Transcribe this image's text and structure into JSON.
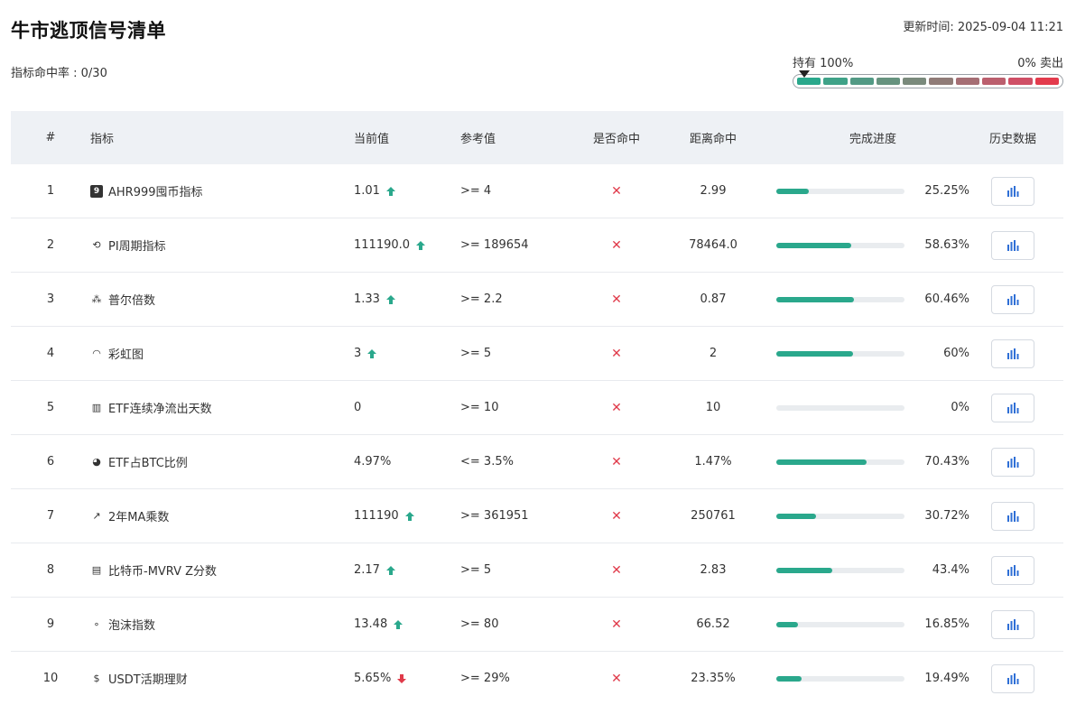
{
  "header": {
    "title": "牛市逃顶信号清单",
    "update_time": "更新时间: 2025-09-04 11:21",
    "hit_rate": "指标命中率 : 0/30"
  },
  "gauge": {
    "left_label": "持有 100%",
    "right_label": "0% 卖出",
    "position_fraction": 0.0,
    "segments": [
      "#2aa88c",
      "#3fa288",
      "#529a85",
      "#66937f",
      "#7a8a7c",
      "#907c78",
      "#a56e74",
      "#bb5f6e",
      "#cf4f66",
      "#e33b4d"
    ]
  },
  "table": {
    "columns": [
      "#",
      "指标",
      "当前值",
      "参考值",
      "是否命中",
      "距离命中",
      "完成进度",
      "历史数据"
    ],
    "rows": [
      {
        "num": "1",
        "icon": "nine-badge-icon",
        "icon_glyph": "9",
        "name": "AHR999囤币指标",
        "current": "1.01",
        "trend": "up",
        "ref": ">= 4",
        "hit": "✕",
        "distance": "2.99",
        "progress": 25.25,
        "progress_label": "25.25%"
      },
      {
        "num": "2",
        "icon": "cycle-icon",
        "icon_glyph": "⟲",
        "name": "PI周期指标",
        "current": "111190.0",
        "trend": "up",
        "ref": ">= 189654",
        "hit": "✕",
        "distance": "78464.0",
        "progress": 58.63,
        "progress_label": "58.63%"
      },
      {
        "num": "3",
        "icon": "sparkle-icon",
        "icon_glyph": "⁂",
        "name": "普尔倍数",
        "current": "1.33",
        "trend": "up",
        "ref": ">= 2.2",
        "hit": "✕",
        "distance": "0.87",
        "progress": 60.46,
        "progress_label": "60.46%"
      },
      {
        "num": "4",
        "icon": "rainbow-icon",
        "icon_glyph": "◠",
        "name": "彩虹图",
        "current": "3",
        "trend": "up",
        "ref": ">= 5",
        "hit": "✕",
        "distance": "2",
        "progress": 60,
        "progress_label": "60%"
      },
      {
        "num": "5",
        "icon": "bar-chart-icon",
        "icon_glyph": "▥",
        "name": "ETF连续净流出天数",
        "current": "0",
        "trend": "none",
        "ref": ">= 10",
        "hit": "✕",
        "distance": "10",
        "progress": 0,
        "progress_label": "0%"
      },
      {
        "num": "6",
        "icon": "pie-chart-icon",
        "icon_glyph": "◕",
        "name": "ETF占BTC比例",
        "current": "4.97%",
        "trend": "none",
        "ref": "<= 3.5%",
        "hit": "✕",
        "distance": "1.47%",
        "progress": 70.43,
        "progress_label": "70.43%"
      },
      {
        "num": "7",
        "icon": "line-chart-icon",
        "icon_glyph": "↗",
        "name": "2年MA乘数",
        "current": "111190",
        "trend": "up",
        "ref": ">= 361951",
        "hit": "✕",
        "distance": "250761",
        "progress": 30.72,
        "progress_label": "30.72%"
      },
      {
        "num": "8",
        "icon": "clipboard-icon",
        "icon_glyph": "▤",
        "name": "比特币-MVRV Z分数",
        "current": "2.17",
        "trend": "up",
        "ref": ">= 5",
        "hit": "✕",
        "distance": "2.83",
        "progress": 43.4,
        "progress_label": "43.4%"
      },
      {
        "num": "9",
        "icon": "bubbles-icon",
        "icon_glyph": "∘",
        "name": "泡沫指数",
        "current": "13.48",
        "trend": "up",
        "ref": ">= 80",
        "hit": "✕",
        "distance": "66.52",
        "progress": 16.85,
        "progress_label": "16.85%"
      },
      {
        "num": "10",
        "icon": "dollar-icon",
        "icon_glyph": "$",
        "name": "USDT活期理财",
        "current": "5.65%",
        "trend": "down",
        "ref": ">= 29%",
        "hit": "✕",
        "distance": "23.35%",
        "progress": 19.49,
        "progress_label": "19.49%"
      }
    ]
  },
  "colors": {
    "up": "#2aa88c",
    "down": "#e03a4a",
    "progress": "#2aa88c",
    "hit_no": "#e03a4a",
    "history_icon": "#2f6fd6"
  }
}
